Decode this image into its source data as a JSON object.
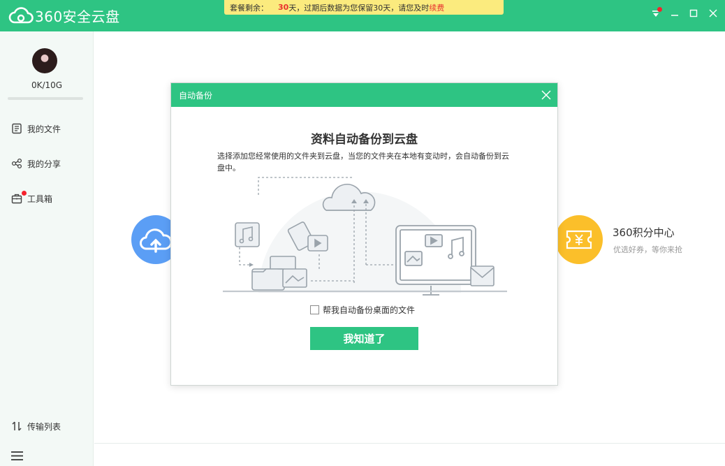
{
  "app": {
    "logo_text": "360安全云盘"
  },
  "notice": {
    "prefix": "套餐剩余：",
    "days": "30",
    "days_suffix": "天",
    "message": "，过期后数据为您保留30天，请您及时",
    "renew": "续费"
  },
  "window_controls": [
    "menu",
    "minimize",
    "maximize",
    "close"
  ],
  "sidebar": {
    "quota": "0K/10G",
    "items": [
      {
        "label": "我的文件",
        "icon": "file-list-icon"
      },
      {
        "label": "我的分享",
        "icon": "share-icon"
      },
      {
        "label": "工具箱",
        "icon": "toolbox-icon",
        "badge": true
      }
    ],
    "transfer": {
      "label": "传输列表",
      "icon": "transfer-icon"
    },
    "menu_icon": "hamburger-icon"
  },
  "background": {
    "points_title": "360积分中心",
    "points_sub": "优选好券，等你来抢"
  },
  "modal": {
    "title": "自动备份",
    "heading": "资料自动备份到云盘",
    "description": "选择添加您经常使用的文件夹到云盘，当您的文件夹在本地有变动时，会自动备份到云盘中。",
    "checkbox_label": "帮我自动备份桌面的文件",
    "checkbox_checked": false,
    "ok_button": "我知道了"
  },
  "colors": {
    "brand_green": "#2ec483",
    "notice_yellow": "#fbeb7e",
    "alert_red": "#e8312f",
    "upload_blue": "#5b9ef5",
    "points_gold": "#fbbf2a"
  }
}
